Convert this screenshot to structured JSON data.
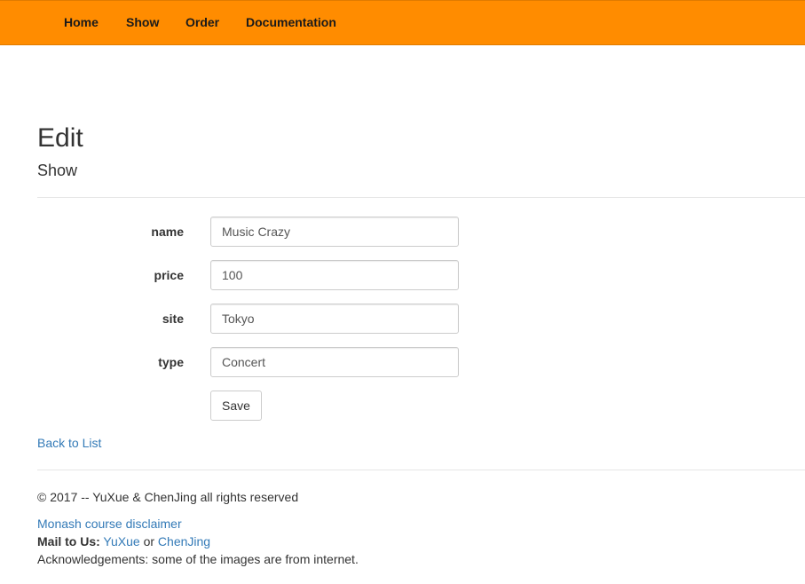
{
  "navbar": {
    "items": [
      {
        "label": "Home"
      },
      {
        "label": "Show"
      },
      {
        "label": "Order"
      },
      {
        "label": "Documentation"
      }
    ]
  },
  "page": {
    "title": "Edit",
    "subtitle": "Show"
  },
  "form": {
    "fields": [
      {
        "label": "name",
        "value": "Music Crazy"
      },
      {
        "label": "price",
        "value": "100"
      },
      {
        "label": "site",
        "value": "Tokyo"
      },
      {
        "label": "type",
        "value": "Concert"
      }
    ],
    "save_label": "Save"
  },
  "back_link": "Back to List",
  "footer": {
    "copyright": "© 2017 -- YuXue & ChenJing all rights reserved",
    "disclaimer_link": "Monash course disclaimer",
    "mail_prefix": "Mail to Us:",
    "mail_person_1": "YuXue",
    "mail_or": "or",
    "mail_person_2": "ChenJing",
    "acknowledgements": "Acknowledgements: some of the images are from internet."
  },
  "colors": {
    "navbar_bg": "#ff8c00",
    "link": "#337ab7"
  }
}
